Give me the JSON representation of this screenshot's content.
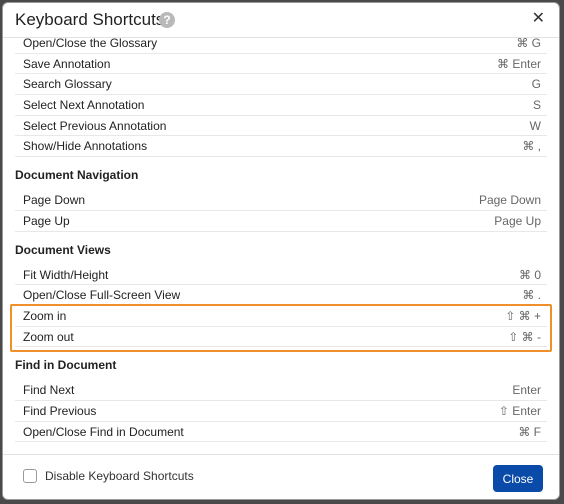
{
  "dialog": {
    "title": "Keyboard Shortcuts",
    "help_icon": "?",
    "close_icon": "✕"
  },
  "sections": [
    {
      "title": "",
      "rows": [
        {
          "label": "Open/Close the Glossary",
          "keys": "⌘ G"
        },
        {
          "label": "Save Annotation",
          "keys": "⌘ Enter"
        },
        {
          "label": "Search Glossary",
          "keys": "G"
        },
        {
          "label": "Select Next Annotation",
          "keys": "S"
        },
        {
          "label": "Select Previous Annotation",
          "keys": "W"
        },
        {
          "label": "Show/Hide Annotations",
          "keys": "⌘ ,"
        }
      ]
    },
    {
      "title": "Document Navigation",
      "rows": [
        {
          "label": "Page Down",
          "keys": "Page Down"
        },
        {
          "label": "Page Up",
          "keys": "Page Up"
        }
      ]
    },
    {
      "title": "Document Views",
      "rows": [
        {
          "label": "Fit Width/Height",
          "keys": "⌘ 0"
        },
        {
          "label": "Open/Close Full-Screen View",
          "keys": "⌘ ."
        },
        {
          "label": "Zoom in",
          "keys": "⇧ ⌘ +"
        },
        {
          "label": "Zoom out",
          "keys": "⇧ ⌘ -"
        }
      ]
    },
    {
      "title": "Find in Document",
      "rows": [
        {
          "label": "Find Next",
          "keys": "Enter"
        },
        {
          "label": "Find Previous",
          "keys": "⇧ Enter"
        },
        {
          "label": "Open/Close Find in Document",
          "keys": "⌘ F"
        }
      ]
    }
  ],
  "footer": {
    "checkbox_label": "Disable Keyboard Shortcuts",
    "checkbox_checked": false,
    "close_label": "Close"
  },
  "colors": {
    "highlight": "#f0902a",
    "primary_button": "#0a4aa8"
  }
}
